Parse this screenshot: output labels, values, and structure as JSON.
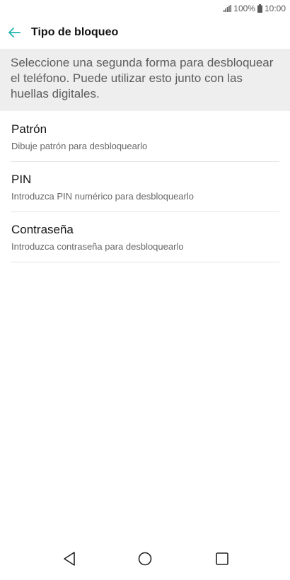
{
  "status_bar": {
    "battery_percent": "100%",
    "time": "10:00",
    "signal_icon": "signal-bars-icon",
    "battery_icon": "battery-full-icon"
  },
  "app_bar": {
    "back_icon": "arrow-left-icon",
    "title": "Tipo de bloqueo",
    "accent_color": "#1fb5ad"
  },
  "description": "Seleccione una segunda forma para desbloquear el teléfono. Puede utilizar esto junto con las huellas digitales.",
  "options": [
    {
      "title": "Patrón",
      "subtitle": "Dibuje patrón para desbloquearlo"
    },
    {
      "title": "PIN",
      "subtitle": "Introduzca PIN numérico para desbloquearlo"
    },
    {
      "title": "Contraseña",
      "subtitle": "Introduzca contraseña para desbloquearlo"
    }
  ],
  "nav_bar": {
    "back_icon": "triangle-back-icon",
    "home_icon": "circle-home-icon",
    "recents_icon": "square-recents-icon"
  }
}
